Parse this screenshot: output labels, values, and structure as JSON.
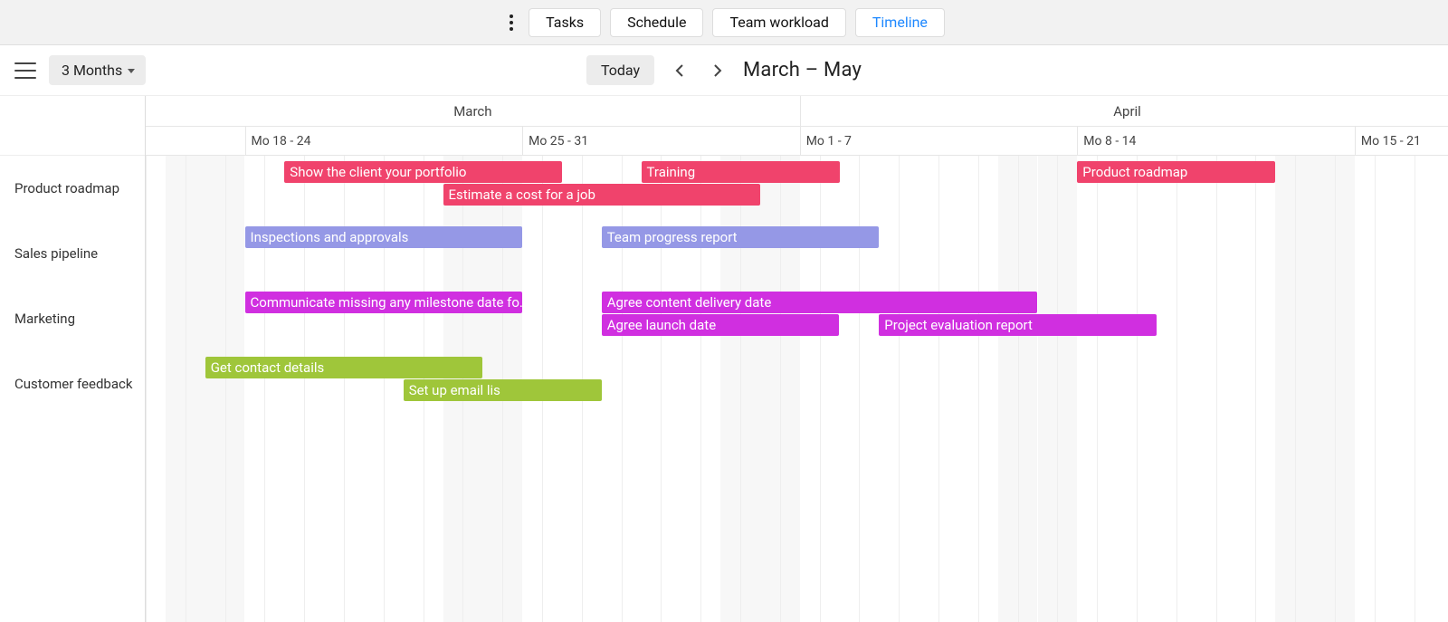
{
  "top_tabs": {
    "tasks": "Tasks",
    "schedule": "Schedule",
    "workload": "Team workload",
    "timeline": "Timeline"
  },
  "toolbar": {
    "range_select": "3 Months",
    "today": "Today",
    "range_title": "March – May"
  },
  "months": [
    {
      "label": "March",
      "left_day": 0,
      "span_days": 16.5
    },
    {
      "label": "April",
      "left_day": 16.5,
      "span_days": 16.5
    }
  ],
  "weeks": [
    {
      "label": "Mo 18 - 24",
      "left_day": 2.5
    },
    {
      "label": "Mo 25 - 31",
      "left_day": 9.5
    },
    {
      "label": "Mo 1 - 7",
      "left_day": 16.5
    },
    {
      "label": "Mo 8 - 14",
      "left_day": 23.5
    },
    {
      "label": "Mo 15 - 21",
      "left_day": 30.5
    }
  ],
  "colors": {
    "red": "#f0436c",
    "purple": "#9598e6",
    "magenta": "#d02fe0",
    "green": "#9fc63a"
  },
  "groups": [
    {
      "name": "Product roadmap",
      "tasks": [
        {
          "label": "Show the client your portfolio",
          "color": "red",
          "start": 3.5,
          "span": 7,
          "lane": 0
        },
        {
          "label": "Training",
          "color": "red",
          "start": 12.5,
          "span": 5,
          "lane": 0
        },
        {
          "label": "Product roadmap",
          "color": "red",
          "start": 23.5,
          "span": 5,
          "lane": 0
        },
        {
          "label": "Estimate a cost for a job",
          "color": "red",
          "start": 7.5,
          "span": 8,
          "lane": 1
        }
      ]
    },
    {
      "name": "Sales pipeline",
      "tasks": [
        {
          "label": "Inspections and approvals",
          "color": "purple",
          "start": 2.5,
          "span": 7,
          "lane": 0
        },
        {
          "label": "Team progress report",
          "color": "purple",
          "start": 11.5,
          "span": 7,
          "lane": 0
        }
      ]
    },
    {
      "name": "Marketing",
      "tasks": [
        {
          "label": "Communicate missing any milestone date fo…",
          "color": "magenta",
          "start": 2.5,
          "span": 7,
          "lane": 0
        },
        {
          "label": "Agree content delivery date",
          "color": "magenta",
          "start": 11.5,
          "span": 11,
          "lane": 0
        },
        {
          "label": "Agree launch date",
          "color": "magenta",
          "start": 11.5,
          "span": 6,
          "lane": 1
        },
        {
          "label": "Project evaluation report",
          "color": "magenta",
          "start": 18.5,
          "span": 7,
          "lane": 1
        }
      ]
    },
    {
      "name": "Customer feedback",
      "tasks": [
        {
          "label": "Get contact details",
          "color": "green",
          "start": 1.5,
          "span": 7,
          "lane": 0
        },
        {
          "label": "Set up email lis",
          "color": "green",
          "start": 6.5,
          "span": 5,
          "lane": 1
        }
      ]
    }
  ]
}
